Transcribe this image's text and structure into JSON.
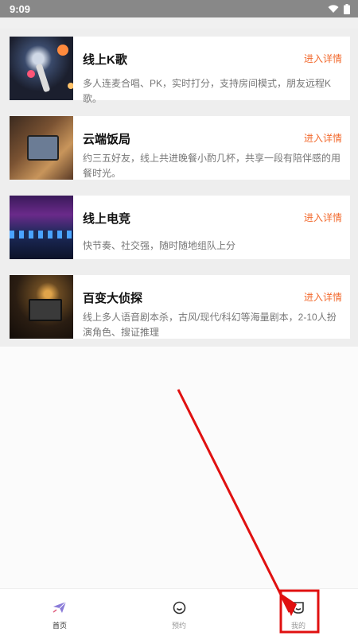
{
  "status_bar": {
    "time": "9:09",
    "icons": [
      "wifi-icon",
      "battery-icon"
    ]
  },
  "cards": [
    {
      "title": "线上K歌",
      "link": "进入详情",
      "desc": "多人连麦合唱、PK，实时打分，支持房间模式，朋友远程K歌。",
      "thumb": "karaoke-thumbnail"
    },
    {
      "title": "云端饭局",
      "link": "进入详情",
      "desc": "约三五好友，线上共进晚餐小酌几杯，共享一段有陪伴感的用餐时光。",
      "thumb": "dining-thumbnail"
    },
    {
      "title": "线上电竞",
      "link": "进入详情",
      "desc": "快节奏、社交强，随时随地组队上分",
      "thumb": "esports-thumbnail"
    },
    {
      "title": "百变大侦探",
      "link": "进入详情",
      "desc": "线上多人语音剧本杀，古风/现代/科幻等海量剧本，2-10人扮演角色、搜证推理",
      "thumb": "detective-thumbnail"
    }
  ],
  "tabs": [
    {
      "label": "首页",
      "icon": "paper-plane-icon",
      "active": true
    },
    {
      "label": "预约",
      "icon": "smile-face-icon",
      "active": false
    },
    {
      "label": "我的",
      "icon": "profile-face-icon",
      "active": false
    }
  ],
  "colors": {
    "accent": "#f26a2e",
    "annotation": "#e01010",
    "status_bar": "#888888"
  }
}
